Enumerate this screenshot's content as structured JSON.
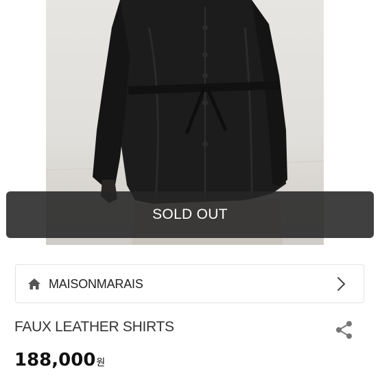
{
  "product": {
    "sold_out_label": "SOLD OUT",
    "seller_name": "MAISONMARAIS",
    "title": "FAUX LEATHER SHIRTS",
    "price": "188,000",
    "currency": "원"
  },
  "icons": {
    "seller": "home-icon",
    "seller_link": "chevron-right-icon",
    "share": "share-icon"
  }
}
